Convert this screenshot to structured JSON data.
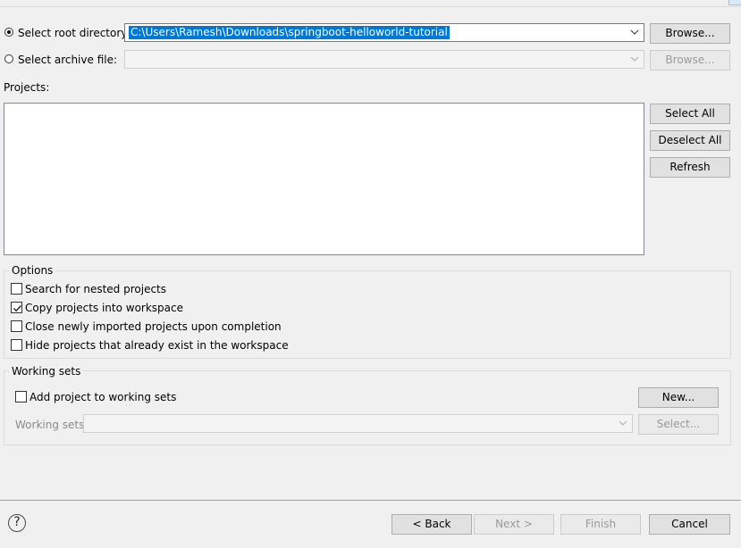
{
  "root_dir": {
    "label": "Select root directory:",
    "value": "C:\\Users\\Ramesh\\Downloads\\springboot-helloworld-tutorial",
    "browse_label": "Browse...",
    "selected": true
  },
  "archive": {
    "label": "Select archive file:",
    "value": "",
    "browse_label": "Browse...",
    "selected": false
  },
  "projects": {
    "label": "Projects:",
    "select_all_label": "Select All",
    "deselect_all_label": "Deselect All",
    "refresh_label": "Refresh"
  },
  "options": {
    "title": "Options",
    "items": [
      {
        "label": "Search for nested projects",
        "checked": false
      },
      {
        "label": "Copy projects into workspace",
        "checked": true
      },
      {
        "label": "Close newly imported projects upon completion",
        "checked": false
      },
      {
        "label": "Hide projects that already exist in the workspace",
        "checked": false
      }
    ]
  },
  "working_sets": {
    "title": "Working sets",
    "add_label": "Add project to working sets",
    "add_checked": false,
    "new_label": "New...",
    "sets_label": "Working sets:",
    "select_label": "Select..."
  },
  "footer": {
    "back_label": "< Back",
    "next_label": "Next >",
    "finish_label": "Finish",
    "cancel_label": "Cancel",
    "help_glyph": "?"
  },
  "icons": {
    "help": "help-icon",
    "dropdown": "chevron-down-icon",
    "check": "check-icon",
    "radio": "radio-icon"
  },
  "colors": {
    "selection": "#0078d7",
    "background": "#f0f0f0"
  }
}
